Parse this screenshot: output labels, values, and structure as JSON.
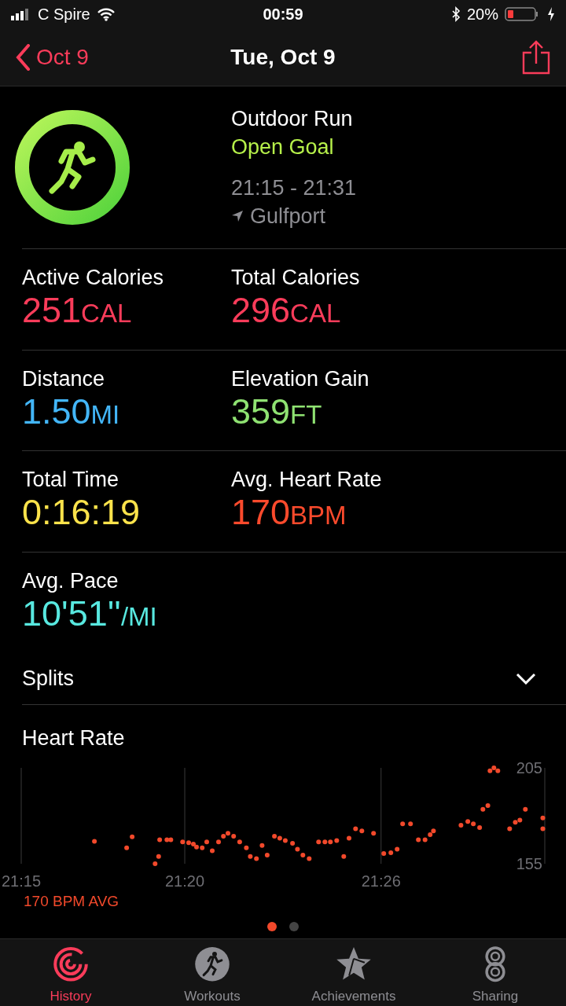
{
  "status_bar": {
    "carrier": "C Spire",
    "time": "00:59",
    "battery": "20%"
  },
  "nav": {
    "back": "Oct 9",
    "title": "Tue, Oct 9"
  },
  "workout": {
    "type": "Outdoor Run",
    "goal": "Open Goal",
    "time_range": "21:15 - 21:31",
    "location": "Gulfport"
  },
  "metrics": [
    {
      "label": "Active Calories",
      "value": "251",
      "unit": "CAL",
      "color": "#fa3c5a"
    },
    {
      "label": "Total Calories",
      "value": "296",
      "unit": "CAL",
      "color": "#fa3c5a"
    },
    {
      "label": "Distance",
      "value": "1.50",
      "unit": "MI",
      "color": "#43b6f8"
    },
    {
      "label": "Elevation Gain",
      "value": "359",
      "unit": "FT",
      "color": "#8fe272"
    },
    {
      "label": "Total Time",
      "value": "0:16:19",
      "color": "#fce34b"
    },
    {
      "label": "Avg. Heart Rate",
      "value": "170",
      "unit": "BPM",
      "color": "#fa4a2c"
    },
    {
      "label": "Avg. Pace",
      "value": "10'51''",
      "unit": "/MI",
      "color": "#58e8e0"
    }
  ],
  "splits": {
    "label": "Splits",
    "expanded": false
  },
  "heart_rate": {
    "average": "170 BPM AVG",
    "chart_data": {
      "type": "scatter",
      "title": "Heart Rate",
      "ylim": [
        155,
        205
      ],
      "xlim": [
        21.25,
        21.5167
      ],
      "yticks": [
        155,
        205
      ],
      "xticks": [
        {
          "value": 21.25,
          "label": "21:15"
        },
        {
          "value": 21.3333,
          "label": "21:20"
        },
        {
          "value": 21.4333,
          "label": "21:26"
        }
      ],
      "x": [
        21.2873,
        21.3037,
        21.3065,
        21.3182,
        21.32,
        21.3205,
        21.3242,
        21.3262,
        21.3322,
        21.3353,
        21.3377,
        21.3393,
        21.3422,
        21.3445,
        21.3473,
        21.3505,
        21.353,
        21.3553,
        21.3582,
        21.3613,
        21.3647,
        21.3667,
        21.3698,
        21.3727,
        21.3753,
        21.379,
        21.3817,
        21.3845,
        21.3882,
        21.3907,
        21.3935,
        21.3967,
        21.4015,
        21.4047,
        21.4075,
        21.4107,
        21.4143,
        21.417,
        21.4203,
        21.4235,
        21.4295,
        21.4347,
        21.4383,
        21.4415,
        21.4443,
        21.4483,
        21.4523,
        21.4557,
        21.4583,
        21.46,
        21.474,
        21.4775,
        21.4803,
        21.4835,
        21.4852,
        21.4877,
        21.4888,
        21.4908,
        21.4928,
        21.4988,
        21.5017,
        21.504,
        21.5068,
        21.5157,
        21.5157
      ],
      "series": [
        {
          "color": "#f2492b",
          "values": [
            166.7,
            163.3,
            169,
            155,
            158.8,
            167.5,
            167.5,
            167.5,
            166.4,
            166,
            165.2,
            163.7,
            163.3,
            166.4,
            161.8,
            166.4,
            169.4,
            170.9,
            169.4,
            166.4,
            163.3,
            158.8,
            157.7,
            164.5,
            159.5,
            169.4,
            168.3,
            167.1,
            165.6,
            162.6,
            159.5,
            157.7,
            166.4,
            166.4,
            166.4,
            167.1,
            158.8,
            168.3,
            173.2,
            172.1,
            170.9,
            160.3,
            160.7,
            162.6,
            175.8,
            175.8,
            167.5,
            167.5,
            170.2,
            172.1,
            175.1,
            177,
            175.8,
            173.9,
            183.4,
            185.3,
            203.5,
            205,
            203.5,
            173.2,
            176.6,
            177.7,
            183.4,
            178.9,
            173.2
          ]
        }
      ]
    }
  },
  "pages": [
    {
      "selected": true
    },
    {
      "selected": false
    }
  ],
  "tabs": [
    {
      "label": "History",
      "kind": "history",
      "selected": true
    },
    {
      "label": "Workouts",
      "kind": "workouts",
      "selected": false
    },
    {
      "label": "Achievements",
      "kind": "achievements",
      "selected": false
    },
    {
      "label": "Sharing",
      "kind": "sharing",
      "selected": false
    }
  ]
}
